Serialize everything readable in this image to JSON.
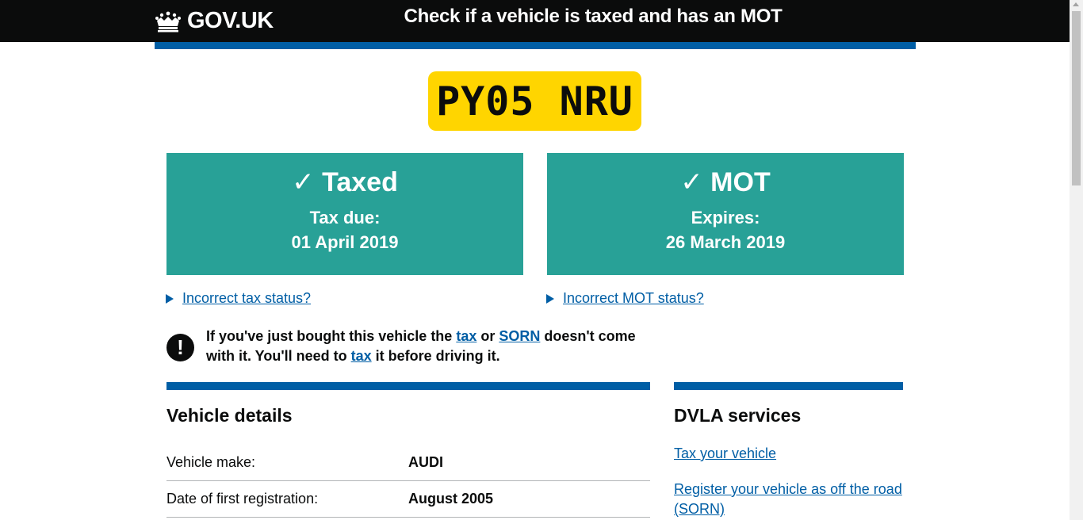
{
  "header": {
    "logo_text": "GOV.UK",
    "service_title": "Check if a vehicle is taxed and has an MOT"
  },
  "vehicle": {
    "registration": "PY05 NRU"
  },
  "tax_status": {
    "heading": "✓ Taxed",
    "label": "Tax due:",
    "date": "01 April 2019",
    "incorrect_link": "Incorrect tax status?"
  },
  "mot_status": {
    "heading": "✓ MOT",
    "label": "Expires:",
    "date": "26 March 2019",
    "incorrect_link": "Incorrect MOT status?"
  },
  "warning": {
    "icon": "!",
    "part1": "If you've just bought this vehicle the ",
    "link_tax": "tax",
    "part2": " or ",
    "link_sorn": "SORN",
    "part3": " doesn't come with it. You'll need to ",
    "link_tax2": "tax",
    "part4": " it before driving it."
  },
  "vehicle_details": {
    "heading": "Vehicle details",
    "rows": [
      {
        "key": "Vehicle make:",
        "value": "AUDI"
      },
      {
        "key": "Date of first registration:",
        "value": "August 2005"
      }
    ]
  },
  "dvla_services": {
    "heading": "DVLA services",
    "links": [
      "Tax your vehicle",
      "Register your vehicle as off the road (SORN)"
    ]
  },
  "colors": {
    "header_bg": "#0b0c0c",
    "brand_blue": "#005ea5",
    "status_green": "#28a197",
    "plate_yellow": "#ffd500"
  }
}
